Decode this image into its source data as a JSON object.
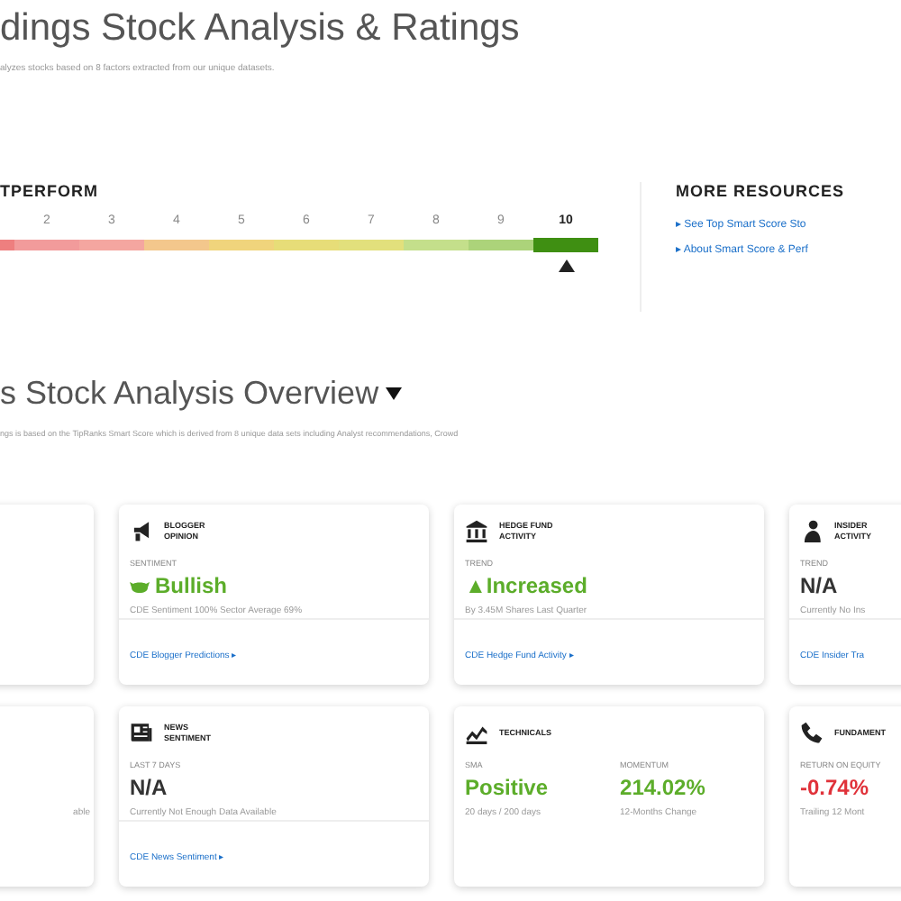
{
  "header": {
    "title": "dings Stock Analysis & Ratings",
    "subtitle": "alyzes stocks based on 8 factors extracted from our unique datasets."
  },
  "smart_score": {
    "heading": "TPERFORM",
    "segments": [
      {
        "color": "#ee7f7f",
        "selected": false
      },
      {
        "label": "2",
        "color": "#f29b9b",
        "selected": false
      },
      {
        "label": "3",
        "color": "#f4a6a0",
        "selected": false
      },
      {
        "label": "4",
        "color": "#f3c78c",
        "selected": false
      },
      {
        "label": "5",
        "color": "#f0d47c",
        "selected": false
      },
      {
        "label": "6",
        "color": "#e7dd78",
        "selected": false
      },
      {
        "label": "7",
        "color": "#e2e07c",
        "selected": false
      },
      {
        "label": "8",
        "color": "#c4df8b",
        "selected": false
      },
      {
        "label": "9",
        "color": "#acd37a",
        "selected": false
      },
      {
        "label": "10",
        "color": "#3f8f12",
        "selected": true
      }
    ]
  },
  "resources": {
    "heading": "MORE RESOURCES",
    "links": [
      "▸ See Top Smart Score Sto",
      "▸ About Smart Score & Perf"
    ]
  },
  "overview": {
    "title": "s Stock Analysis Overview",
    "description": "ngs is based on the TipRanks Smart Score which is derived from 8 unique data sets including Analyst recommendations, Crowd"
  },
  "card_rows": [
    [
      {
        "kind": "blank"
      },
      {
        "kind": "speaker",
        "title": [
          "BLOGGER",
          "OPINION"
        ],
        "metrics": [
          {
            "label": "SENTIMENT",
            "kind": "sentiment",
            "value": "Bullish",
            "color": "#5cad2a",
            "detail": "CDE Sentiment 100%  Sector Average 69%"
          }
        ],
        "link": "CDE Blogger Predictions ▸"
      },
      {
        "kind": "bank",
        "title": [
          "HEDGE FUND",
          "ACTIVITY"
        ],
        "metrics": [
          {
            "kind": "plain",
            "label": "TREND",
            "value": "▲Increased",
            "color": "#5cad2a",
            "detail": "By 3.45M Shares Last Quarter"
          }
        ],
        "link": "CDE Hedge Fund Activity ▸"
      },
      {
        "kind": "person",
        "title": [
          "INSIDER",
          "ACTIVITY"
        ],
        "metrics": [
          {
            "kind": "plain",
            "label": "TREND",
            "value": "N/A",
            "color": "#333333",
            "detail": "Currently No Ins"
          }
        ],
        "link": "CDE Insider Tra"
      }
    ],
    [
      {
        "kind": "blank",
        "note": "able"
      },
      {
        "kind": "news",
        "title": [
          "NEWS",
          "SENTIMENT"
        ],
        "metrics": [
          {
            "kind": "plain",
            "label": "LAST 7 DAYS",
            "value": "N/A",
            "color": "#333333",
            "detail": "Currently Not Enough Data Available"
          }
        ],
        "link": "CDE News Sentiment ▸"
      },
      {
        "kind": "chart",
        "title": [
          "TECHNICALS"
        ],
        "metrics": [
          {
            "kind": "plain",
            "label": "SMA",
            "value": "Positive",
            "color": "#5cad2a",
            "detail": "20 days / 200 days"
          },
          {
            "kind": "plain",
            "label": "MOMENTUM",
            "value": "214.02%",
            "color": "#5cad2a",
            "detail": "12-Months Change"
          }
        ]
      },
      {
        "kind": "phone",
        "title": [
          "FUNDAMENT"
        ],
        "metrics": [
          {
            "kind": "plain",
            "label": "RETURN ON EQUITY",
            "value": "-0.74%",
            "color": "#e0323a",
            "detail": "Trailing 12 Mont"
          }
        ]
      }
    ]
  ]
}
